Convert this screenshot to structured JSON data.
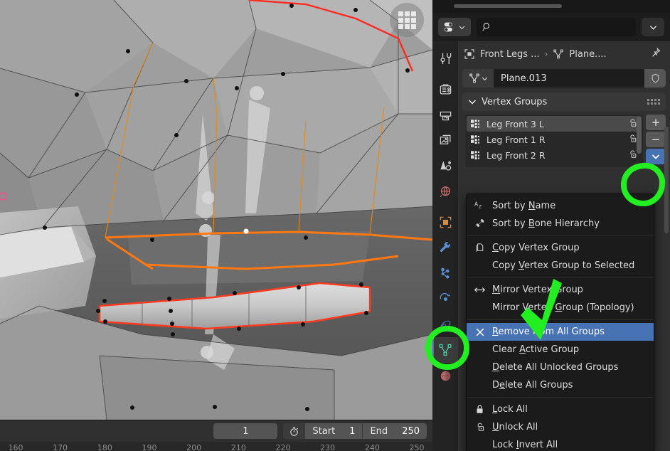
{
  "app": "Blender",
  "viewport": {
    "name": "3d-viewport",
    "overlay_icon": "grid-icon",
    "mode": "Edit Mode",
    "mesh_color": "#9a9a9a",
    "selection_color": "#ff7811",
    "seam_color": "#ff2020"
  },
  "timeline": {
    "current_frame": "1",
    "clock_icon": "timer-icon",
    "start_label": "Start",
    "start_value": "1",
    "end_label": "End",
    "end_value": "250",
    "ruler_ticks": [
      "160",
      "170",
      "180",
      "190",
      "200",
      "210",
      "220",
      "230",
      "240",
      "250"
    ]
  },
  "properties": {
    "editor_type_icon": "editor-type-icon",
    "search": {
      "placeholder": "",
      "value": "",
      "icon": "search-icon"
    },
    "header_chevron": "chevron-down-icon",
    "breadcrumb": {
      "object_icon": "object-icon",
      "object": "Front Legs ...",
      "separator": "›",
      "data_icon": "mesh-data-icon",
      "data": "Plane....",
      "pin_icon": "pin-icon"
    },
    "id_block": {
      "icon": "mesh-data-icon",
      "chevron": "chevron-down-icon",
      "name": "Plane.013",
      "shield_icon": "shield-icon"
    },
    "tabs": [
      {
        "name": "tool",
        "icon": "tool-icon",
        "color": "#d0d0d0",
        "active": false
      },
      {
        "name": "render",
        "icon": "camera-back-icon",
        "color": "#d0d0d0",
        "active": false
      },
      {
        "name": "output",
        "icon": "printer-icon",
        "color": "#d0d0d0",
        "active": false
      },
      {
        "name": "view-layer",
        "icon": "images-icon",
        "color": "#d0d0d0",
        "active": false
      },
      {
        "name": "scene",
        "icon": "cone-sphere-icon",
        "color": "#d0d0d0",
        "active": false
      },
      {
        "name": "world",
        "icon": "world-icon",
        "color": "#c96b6b",
        "active": false
      },
      {
        "name": "object",
        "icon": "square-bracket-icon",
        "color": "#d98a3a",
        "active": false
      },
      {
        "name": "modifiers",
        "icon": "wrench-icon",
        "color": "#5c8ed4",
        "active": false
      },
      {
        "name": "particles",
        "icon": "particles-icon",
        "color": "#5c8ed4",
        "active": false
      },
      {
        "name": "physics",
        "icon": "physics-icon",
        "color": "#5c8ed4",
        "active": false
      },
      {
        "name": "constraints",
        "icon": "constraint-icon",
        "color": "#5c8ed4",
        "active": false
      },
      {
        "name": "object-data",
        "icon": "mesh-data-icon",
        "color": "#4ec9a0",
        "active": true
      },
      {
        "name": "material",
        "icon": "material-icon",
        "color": "#c96b6b",
        "active": false
      }
    ],
    "vertex_groups_panel": {
      "title": "Vertex Groups",
      "collapse_icon": "chevron-down-icon",
      "grip_icon": "grip-dots-icon",
      "items": [
        {
          "name": "Leg Front 3 L",
          "icon": "vertex-group-icon",
          "lock_icon": "unlock-icon",
          "active": true
        },
        {
          "name": "Leg Front 1 R",
          "icon": "vertex-group-icon",
          "lock_icon": "unlock-icon",
          "active": false
        },
        {
          "name": "Leg Front 2 R",
          "icon": "vertex-group-icon",
          "lock_icon": "unlock-icon",
          "active": false
        }
      ],
      "add_button": "+",
      "remove_button": "−",
      "specials_button_icon": "chevron-down-icon"
    }
  },
  "context_menu": {
    "highlighted": "Remove from All Groups",
    "groups": [
      {
        "items": [
          {
            "label_pre": "Sort by ",
            "accel": "N",
            "label_post": "ame",
            "icon": "sort-alpha-icon"
          },
          {
            "label_pre": "Sort by ",
            "accel": "B",
            "label_post": "one Hierarchy",
            "icon": "bone-icon"
          }
        ]
      },
      {
        "items": [
          {
            "label_pre": "",
            "accel": "C",
            "label_post": "opy Vertex Group",
            "icon": "copy-icon"
          },
          {
            "label_pre": "Copy ",
            "accel": "V",
            "label_post": "ertex Group to Selected",
            "icon": ""
          }
        ]
      },
      {
        "items": [
          {
            "label_pre": "",
            "accel": "M",
            "label_post": "irror Vertex Group",
            "icon": "mirror-icon"
          },
          {
            "label_pre": "Mirror Vertex ",
            "accel": "G",
            "label_post": "roup (Topology)",
            "icon": ""
          }
        ]
      },
      {
        "items": [
          {
            "label_pre": "",
            "accel": "R",
            "label_post": "emove from All Groups",
            "icon": "x-icon",
            "highlighted": true
          },
          {
            "label_pre": "Clear ",
            "accel": "A",
            "label_post": "ctive Group",
            "icon": ""
          },
          {
            "label_pre": "",
            "accel": "D",
            "label_post": "elete All Unlocked Groups",
            "icon": ""
          },
          {
            "label_pre": "D",
            "accel": "e",
            "label_post": "lete All Groups",
            "icon": ""
          }
        ]
      },
      {
        "items": [
          {
            "label_pre": "",
            "accel": "L",
            "label_post": "ock All",
            "icon": "lock-icon"
          },
          {
            "label_pre": "",
            "accel": "U",
            "label_post": "nlock All",
            "icon": "unlock-icon"
          },
          {
            "label_pre": "Lock ",
            "accel": "I",
            "label_post": "nvert All",
            "icon": ""
          }
        ]
      }
    ]
  },
  "annotations": {
    "color": "#22ee22",
    "marks": [
      {
        "name": "circle-specials-chevron",
        "shape": "circle"
      },
      {
        "name": "circle-object-data-tab",
        "shape": "circle"
      },
      {
        "name": "arrow-remove-from-all-groups",
        "shape": "arrow"
      }
    ]
  }
}
